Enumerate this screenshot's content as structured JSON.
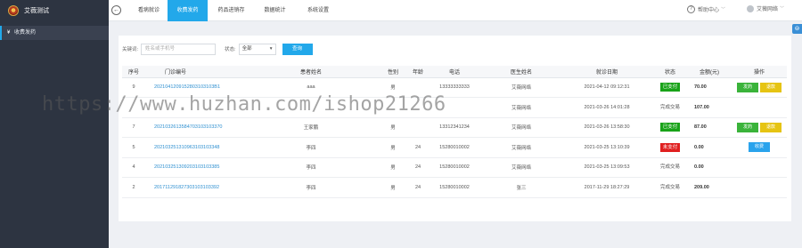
{
  "app": {
    "title": "艾薇测试"
  },
  "header": {
    "back_glyph": "←",
    "tabs": [
      {
        "label": "看病就诊"
      },
      {
        "label": "收费发药"
      },
      {
        "label": "药品进销存"
      },
      {
        "label": "数据统计"
      },
      {
        "label": "系统设置"
      }
    ],
    "help_label": "帮助中心",
    "user_label": "艾薇网络"
  },
  "sidebar": {
    "items": [
      {
        "icon": "yen-icon",
        "glyph": "¥",
        "label": "收费发药"
      }
    ]
  },
  "filter": {
    "keyword_label": "关键词:",
    "keyword_placeholder": "姓名或手机号",
    "status_label": "状态:",
    "status_value": "全部",
    "search_label": "查询"
  },
  "table": {
    "headers": [
      "序号",
      "门诊编号",
      "患者姓名",
      "性别",
      "年龄",
      "电话",
      "医生姓名",
      "就诊日期",
      "状态",
      "金额(元)",
      "操作"
    ],
    "rows": [
      {
        "no": "9",
        "id": "2021041209152803103103B1",
        "name": "aaa",
        "gender": "男",
        "age": "",
        "phone": "13333333333",
        "doctor": "艾薇网络",
        "date": "2021-04-12 09:12:31",
        "status": "已支付",
        "status_type": "paid",
        "amount": "70.00",
        "ops": [
          "发药",
          "退款"
        ]
      },
      {
        "no": "",
        "id": "",
        "name": "",
        "gender": "",
        "age": "",
        "phone": "",
        "doctor": "艾薇网络",
        "date": "2021-03-26 14:01:28",
        "status": "完成交易",
        "status_type": "done",
        "amount": "107.00",
        "ops": []
      },
      {
        "no": "7",
        "id": "2021032613584703103103370",
        "name": "王家鹏",
        "gender": "男",
        "age": "",
        "phone": "13312341234",
        "doctor": "艾薇网络",
        "date": "2021-03-26 13:58:30",
        "status": "已支付",
        "status_type": "paid",
        "amount": "87.00",
        "ops": [
          "发药",
          "退款"
        ]
      },
      {
        "no": "5",
        "id": "202103251310963103103348",
        "name": "李四",
        "gender": "男",
        "age": "24",
        "phone": "15280010002",
        "doctor": "艾薇网络",
        "date": "2021-03-25 13:10:39",
        "status": "未支付",
        "status_type": "unpaid",
        "amount": "0.00",
        "ops": [
          "收费"
        ]
      },
      {
        "no": "4",
        "id": "202103251309203103103385",
        "name": "李四",
        "gender": "男",
        "age": "24",
        "phone": "15280010002",
        "doctor": "艾薇网络",
        "date": "2021-03-25 13:09:53",
        "status": "完成交易",
        "status_type": "done",
        "amount": "0.00",
        "ops": []
      },
      {
        "no": "2",
        "id": "201711291827303103103392",
        "name": "李四",
        "gender": "男",
        "age": "24",
        "phone": "15280010002",
        "doctor": "张三",
        "date": "2017-11-29 18:27:29",
        "status": "完成交易",
        "status_type": "done",
        "amount": "209.00",
        "ops": []
      }
    ]
  },
  "watermark": "https://www.huzhan.com/ishop21266",
  "colors": {
    "accent": "#22a8ea",
    "sidebar": "#2d3441",
    "paid": "#19a319",
    "unpaid": "#e02020",
    "op_green": "#3ab33a",
    "op_yellow": "#e6c413"
  }
}
